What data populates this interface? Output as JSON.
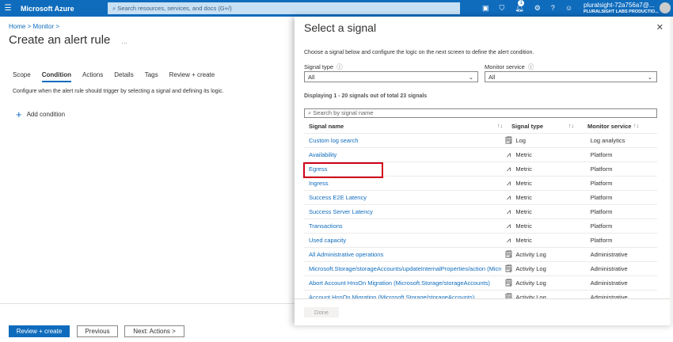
{
  "topbar": {
    "brand": "Microsoft Azure",
    "search_placeholder": "Search resources, services, and docs (G+/)",
    "notification_count": "1",
    "user_name": "pluralsight-72a756a7@...",
    "user_org": "PLURALSIGHT LABS PRODUCTIO..."
  },
  "left": {
    "breadcrumb": [
      "Home",
      "Monitor"
    ],
    "title": "Create an alert rule",
    "more": "...",
    "tabs": [
      "Scope",
      "Condition",
      "Actions",
      "Details",
      "Tags",
      "Review + create"
    ],
    "active_tab": "Condition",
    "description": "Configure when the alert rule should trigger by selecting a signal and defining its logic.",
    "add_condition": "Add condition",
    "buttons": {
      "review": "Review + create",
      "previous": "Previous",
      "next": "Next: Actions >"
    }
  },
  "panel": {
    "title": "Select a signal",
    "description": "Choose a signal below and configure the logic on the next screen to define the alert condition.",
    "signal_type_label": "Signal type",
    "signal_type_value": "All",
    "monitor_service_label": "Monitor service",
    "monitor_service_value": "All",
    "displaying": "Displaying 1 - 20 signals out of total 23 signals",
    "search_placeholder": "Search by signal name",
    "columns": [
      "Signal name",
      "Signal type",
      "Monitor service"
    ],
    "rows": [
      {
        "name": "Custom log search",
        "type": "Log",
        "icon": "log-icon",
        "service": "Log analytics"
      },
      {
        "name": "Availability",
        "type": "Metric",
        "icon": "metric-icon",
        "service": "Platform"
      },
      {
        "name": "Egress",
        "type": "Metric",
        "icon": "metric-icon",
        "service": "Platform"
      },
      {
        "name": "Ingress",
        "type": "Metric",
        "icon": "metric-icon",
        "service": "Platform"
      },
      {
        "name": "Success E2E Latency",
        "type": "Metric",
        "icon": "metric-icon",
        "service": "Platform"
      },
      {
        "name": "Success Server Latency",
        "type": "Metric",
        "icon": "metric-icon",
        "service": "Platform"
      },
      {
        "name": "Transactions",
        "type": "Metric",
        "icon": "metric-icon",
        "service": "Platform"
      },
      {
        "name": "Used capacity",
        "type": "Metric",
        "icon": "metric-icon",
        "service": "Platform"
      },
      {
        "name": "All Administrative operations",
        "type": "Activity Log",
        "icon": "log-icon",
        "service": "Administrative"
      },
      {
        "name": "Microsoft.Storage/storageAccounts/updateInternalProperties/action (Microsoft...",
        "type": "Activity Log",
        "icon": "log-icon",
        "service": "Administrative"
      },
      {
        "name": "Abort Account HnsOn Migration (Microsoft.Storage/storageAccounts)",
        "type": "Activity Log",
        "icon": "log-icon",
        "service": "Administrative"
      },
      {
        "name": "Account HnsOn Migration (Microsoft.Storage/storageAccounts)",
        "type": "Activity Log",
        "icon": "log-icon",
        "service": "Administrative"
      }
    ],
    "highlighted_row": "Egress",
    "done": "Done"
  },
  "colors": {
    "accent": "#0f6cbd",
    "highlight": "#d0021b"
  }
}
